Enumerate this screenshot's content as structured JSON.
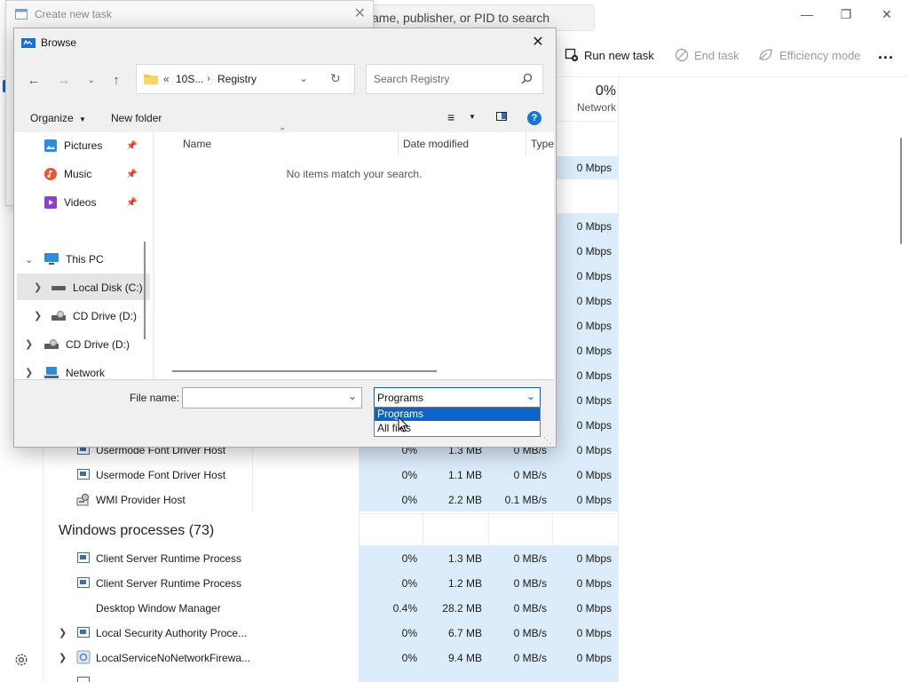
{
  "task_manager": {
    "search_placeholder": "ame, publisher, or PID to search",
    "toolbar": {
      "run_new_task": "Run new task",
      "end_task": "End task",
      "efficiency_mode": "Efficiency mode",
      "more": "..."
    },
    "network_column": {
      "percent": "0%",
      "label": "Network"
    },
    "top_network_values": [
      "0 Mbps",
      "0 Mbps",
      "0 Mbps",
      "0 Mbps",
      "0 Mbps",
      "0 Mbps",
      "0 Mbps",
      "0 Mbps",
      "0 Mbps",
      "0 Mbps",
      "0 Mbps",
      "0 Mbps"
    ],
    "background_rows": [
      {
        "name": "Usermode Font Driver Host",
        "cpu": "0%",
        "memory": "1.3 MB",
        "disk": "0 MB/s",
        "network": "0 Mbps"
      },
      {
        "name": "Usermode Font Driver Host",
        "cpu": "0%",
        "memory": "1.1 MB",
        "disk": "0 MB/s",
        "network": "0 Mbps"
      },
      {
        "name": "WMI Provider Host",
        "cpu": "0%",
        "memory": "2.2 MB",
        "disk": "0.1 MB/s",
        "network": "0 Mbps"
      }
    ],
    "windows_group_title": "Windows processes (73)",
    "windows_rows": [
      {
        "name": "Client Server Runtime Process",
        "cpu": "0%",
        "memory": "1.3 MB",
        "disk": "0 MB/s",
        "network": "0 Mbps"
      },
      {
        "name": "Client Server Runtime Process",
        "cpu": "0%",
        "memory": "1.2 MB",
        "disk": "0 MB/s",
        "network": "0 Mbps"
      },
      {
        "name": "Desktop Window Manager",
        "cpu": "0.4%",
        "memory": "28.2 MB",
        "disk": "0 MB/s",
        "network": "0 Mbps"
      },
      {
        "name": "Local Security Authority Proce...",
        "cpu": "0%",
        "memory": "6.7 MB",
        "disk": "0 MB/s",
        "network": "0 Mbps"
      },
      {
        "name": "LocalServiceNoNetworkFirewa...",
        "cpu": "0%",
        "memory": "9.4 MB",
        "disk": "0 MB/s",
        "network": "0 Mbps"
      }
    ]
  },
  "create_task": {
    "title": "Create new task"
  },
  "browse": {
    "title": "Browse",
    "address": {
      "prefix": "«",
      "segment1": "10S...",
      "segment2": "Registry"
    },
    "search_placeholder": "Search Registry",
    "organize": "Organize",
    "new_folder": "New folder",
    "nav_items": {
      "pictures": "Pictures",
      "music": "Music",
      "videos": "Videos",
      "this_pc": "This PC",
      "local_disk": "Local Disk (C:)",
      "cd_drive_1": "CD Drive (D:)",
      "cd_drive_2": "CD Drive (D:)",
      "network": "Network"
    },
    "columns": {
      "name": "Name",
      "date_modified": "Date modified",
      "type": "Type"
    },
    "empty_message": "No items match your search.",
    "file_name_label": "File name:",
    "file_name_value": "",
    "file_type_selected": "Programs",
    "file_type_options": [
      "Programs",
      "All files"
    ]
  }
}
